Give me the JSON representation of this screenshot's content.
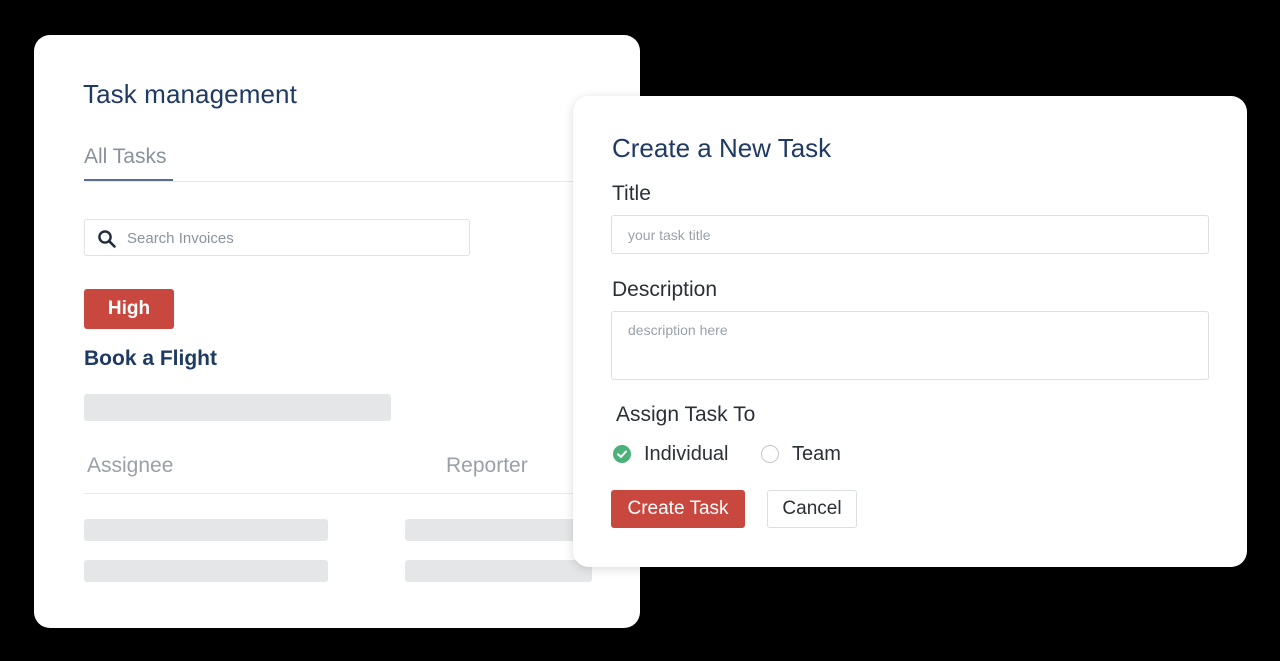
{
  "task_management": {
    "title": "Task management",
    "tabs": [
      {
        "label": "All Tasks",
        "active": true
      }
    ],
    "search": {
      "placeholder": "Search Invoices",
      "icon": "search-icon"
    },
    "task": {
      "priority": "High",
      "name": "Book a Flight"
    },
    "columns": {
      "assignee": "Assignee",
      "reporter": "Reporter"
    }
  },
  "create_task_modal": {
    "title": "Create a New Task",
    "title_field": {
      "label": "Title",
      "placeholder": "your task title",
      "value": ""
    },
    "description_field": {
      "label": "Description",
      "placeholder": "description here",
      "value": ""
    },
    "assign": {
      "label": "Assign Task To",
      "options": [
        {
          "label": "Individual",
          "selected": true
        },
        {
          "label": "Team",
          "selected": false
        }
      ]
    },
    "buttons": {
      "create": "Create Task",
      "cancel": "Cancel"
    }
  },
  "colors": {
    "accent_red": "#c8473f",
    "heading_blue": "#1f3a63",
    "check_green": "#4bb07a",
    "skeleton_gray": "#e5e6e8"
  }
}
